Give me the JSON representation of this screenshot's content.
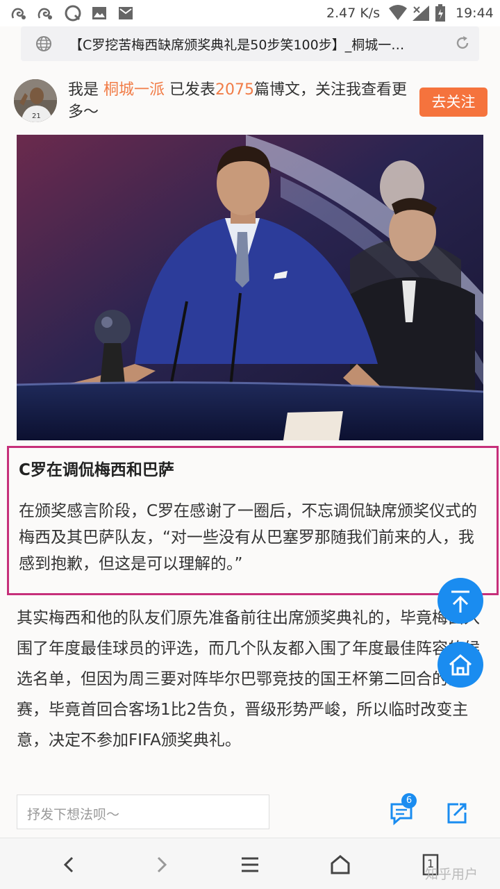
{
  "status_bar": {
    "speed": "2.47 K/s",
    "time": "19:44"
  },
  "url_bar": {
    "title": "【C罗挖苦梅西缺席颁奖典礼是50步笑100步】_桐城一…"
  },
  "author": {
    "prefix": "我是",
    "name": "桐城一派",
    "middle": "已发表",
    "count": "2075",
    "suffix": "篇博文，关注我查看更多～",
    "follow_label": "去关注"
  },
  "article": {
    "subtitle": "C罗在调侃梅西和巴萨",
    "quote_paragraph": "在颁奖感言阶段，C罗在感谢了一圈后，不忘调侃缺席颁奖仪式的梅西及其巴萨队友，“对一些没有从巴塞罗那随我们前来的人，我感到抱歉，但这是可以理解的。”",
    "paragraph": "其实梅西和他的队友们原先准备前往出席颁奖典礼的，毕竟梅西入围了年度最佳球员的评选，而几个队友都入围了年度最佳阵容的候选名单，但因为周三要对阵毕尔巴鄂竞技的国王杯第二回合的比赛，毕竟首回合客场1比2告负，晋级形势严峻，所以临时改变主意，决定不参加FIFA颁奖典礼。"
  },
  "comment_bar": {
    "placeholder": "抒发下想法呗～",
    "comment_count": "6"
  },
  "nav": {
    "tabs_count": "1"
  },
  "watermark": "知乎用户",
  "colors": {
    "accent_orange": "#f5733d",
    "fab_blue": "#1a8cf0",
    "highlight_border": "#c62f7a"
  },
  "icons": [
    "uc-icon",
    "uc-icon",
    "q-icon",
    "image-icon",
    "mail-icon",
    "wifi-icon",
    "signal-icon",
    "battery-icon",
    "globe-icon",
    "reload-icon",
    "scroll-top-icon",
    "home-icon",
    "comment-icon",
    "share-icon",
    "back-icon",
    "forward-icon",
    "menu-icon",
    "home-nav-icon",
    "tabs-icon"
  ]
}
